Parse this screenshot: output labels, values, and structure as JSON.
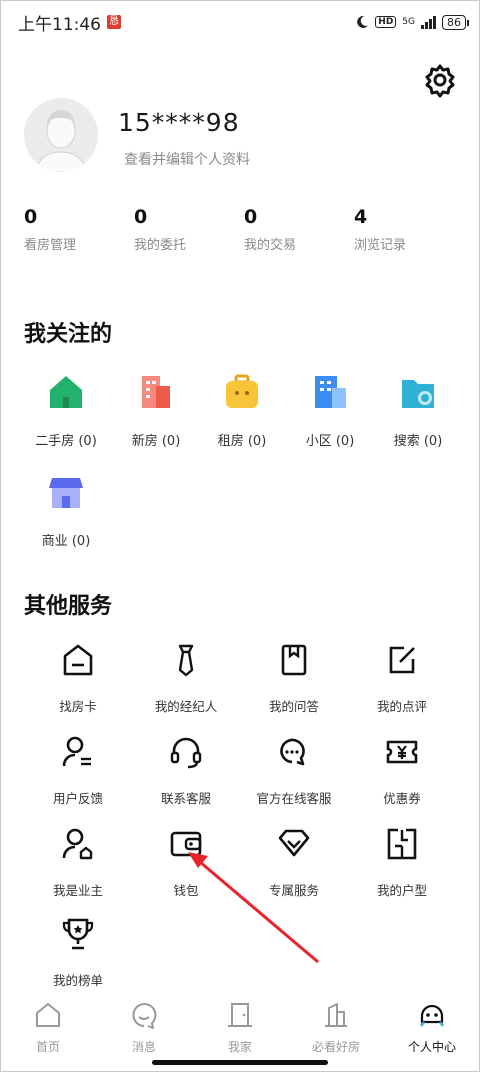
{
  "status_bar": {
    "time": "上午11:46",
    "notification_glyph": "恳",
    "network": "5G",
    "hd": "HD",
    "battery": "86"
  },
  "profile": {
    "phone": "15****98",
    "subtitle": "查看并编辑个人资料"
  },
  "stats": [
    {
      "value": "0",
      "label": "看房管理"
    },
    {
      "value": "0",
      "label": "我的委托"
    },
    {
      "value": "0",
      "label": "我的交易"
    },
    {
      "value": "4",
      "label": "浏览记录"
    }
  ],
  "follow": {
    "title": "我关注的",
    "items": [
      {
        "label": "二手房 (0)",
        "icon": "house-icon",
        "color": "#23b26d"
      },
      {
        "label": "新房 (0)",
        "icon": "building-icon",
        "color": "#f06a5b"
      },
      {
        "label": "租房 (0)",
        "icon": "suitcase-icon",
        "color": "#f5b825"
      },
      {
        "label": "小区 (0)",
        "icon": "community-icon",
        "color": "#3b8df0"
      },
      {
        "label": "搜索 (0)",
        "icon": "search-folder-icon",
        "color": "#2fb1d6"
      },
      {
        "label": "商业 (0)",
        "icon": "store-icon",
        "color": "#5b6bef"
      }
    ]
  },
  "services": {
    "title": "其他服务",
    "items": [
      {
        "label": "找房卡",
        "icon": "card-icon"
      },
      {
        "label": "我的经纪人",
        "icon": "tie-icon"
      },
      {
        "label": "我的问答",
        "icon": "book-icon"
      },
      {
        "label": "我的点评",
        "icon": "edit-icon"
      },
      {
        "label": "用户反馈",
        "icon": "feedback-user-icon"
      },
      {
        "label": "联系客服",
        "icon": "headset-icon"
      },
      {
        "label": "官方在线客服",
        "icon": "chat-bubbles-icon"
      },
      {
        "label": "优惠券",
        "icon": "coupon-icon"
      },
      {
        "label": "我是业主",
        "icon": "owner-icon"
      },
      {
        "label": "钱包",
        "icon": "wallet-icon"
      },
      {
        "label": "专属服务",
        "icon": "diamond-icon"
      },
      {
        "label": "我的户型",
        "icon": "floorplan-icon"
      },
      {
        "label": "我的榜单",
        "icon": "trophy-icon"
      }
    ]
  },
  "nav": {
    "items": [
      {
        "label": "首页",
        "icon": "home-icon",
        "active": false
      },
      {
        "label": "消息",
        "icon": "message-icon",
        "active": false
      },
      {
        "label": "我家",
        "icon": "door-icon",
        "active": false
      },
      {
        "label": "必看好房",
        "icon": "tower-icon",
        "active": false
      },
      {
        "label": "个人中心",
        "icon": "profile-icon",
        "active": true
      }
    ]
  },
  "colors": {
    "accent_arrow": "#e8242a",
    "muted_text": "#8a8a8a"
  }
}
